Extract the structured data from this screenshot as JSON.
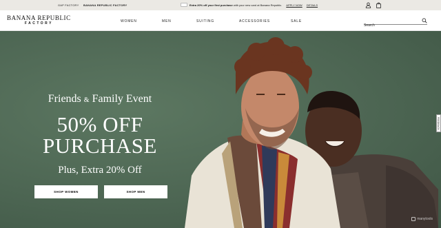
{
  "topbar": {
    "brands": [
      "GAP FACTORY",
      "BANANA REPUBLIC FACTORY"
    ],
    "promo_bold": "Extra 20% off your first purchase",
    "promo_rest": "with your new card at Banana Republic.",
    "apply_now": "APPLY NOW",
    "details": "DETAILS",
    "icons": [
      "account-icon",
      "shopping-bag-icon"
    ]
  },
  "header": {
    "logo_main": "BANANA REPUBLIC",
    "logo_sub": "FACTORY",
    "nav": [
      "WOMEN",
      "MEN",
      "SUITING",
      "ACCESSORIES",
      "SALE"
    ],
    "search_placeholder": "Search"
  },
  "hero": {
    "kicker_a": "Friends",
    "kicker_amp": "&",
    "kicker_b": "Family Event",
    "headline_1": "50% OFF",
    "headline_2": "PURCHASE",
    "subhead": "Plus, Extra 20% Off",
    "cta_women": "SHOP WOMEN",
    "cta_men": "SHOP MEN",
    "feedback_label": "FEEDBACK",
    "watermark": "manytools",
    "colors": {
      "background": "#4f6a55",
      "text": "#ffffff"
    }
  }
}
